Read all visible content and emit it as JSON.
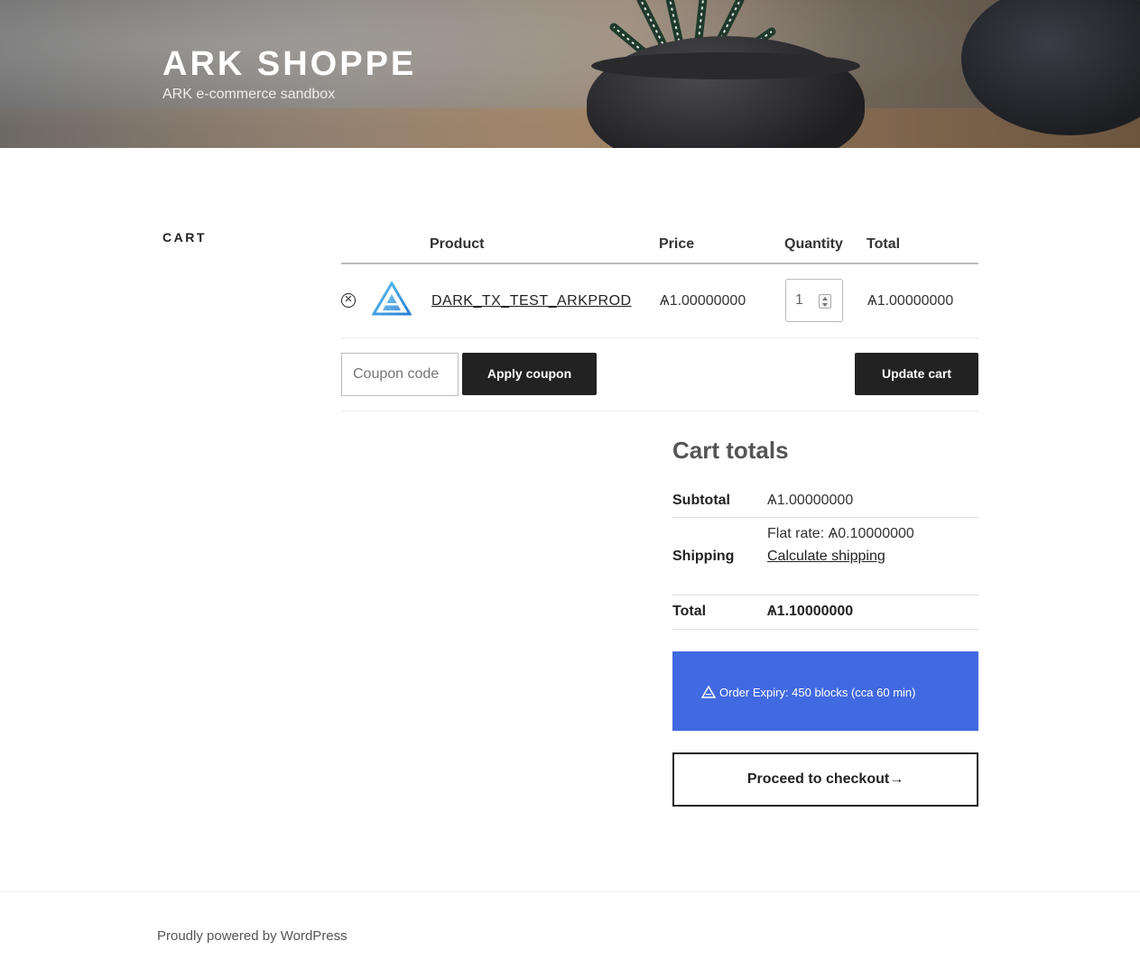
{
  "header": {
    "site_title": "ARK SHOPPE",
    "site_description": "ARK e-commerce sandbox"
  },
  "page": {
    "title": "CART"
  },
  "cart_table": {
    "columns": {
      "product": "Product",
      "price": "Price",
      "quantity": "Quantity",
      "total": "Total"
    },
    "items": [
      {
        "remove_icon": "remove-circle-x-icon",
        "thumbnail_icon": "ark-logo-icon",
        "name": "DARK_TX_TEST_ARKPROD",
        "price": "Ѧ1.00000000",
        "quantity": "1",
        "total": "Ѧ1.00000000"
      }
    ],
    "coupon_placeholder": "Coupon code",
    "apply_coupon_label": "Apply coupon",
    "update_cart_label": "Update cart"
  },
  "cart_totals": {
    "title": "Cart totals",
    "subtotal_label": "Subtotal",
    "subtotal_value": "Ѧ1.00000000",
    "shipping_label": "Shipping",
    "shipping_rate": "Flat rate: Ѧ0.10000000",
    "calculate_shipping": "Calculate shipping",
    "total_label": "Total",
    "total_value": "Ѧ1.10000000",
    "expiry_text": "Order Expiry: 450 blocks (cca 60 min)",
    "expiry_color": "#4169e1",
    "checkout_label": "Proceed to checkout→"
  },
  "footer": {
    "powered_by": "Proudly powered by WordPress"
  }
}
